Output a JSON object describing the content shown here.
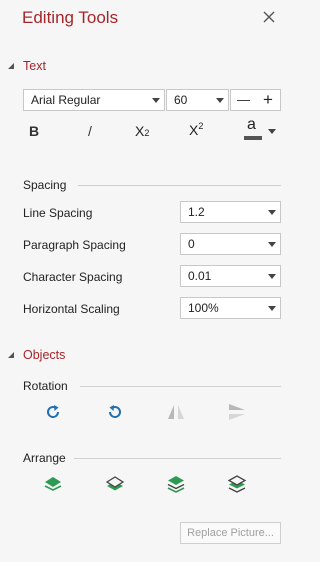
{
  "panel": {
    "title": "Editing Tools"
  },
  "text_section": {
    "header": "Text",
    "font_family": "Arial Regular",
    "font_size": "60",
    "decrease": "—",
    "increase": "+",
    "bold": "B",
    "italic": "/",
    "subscript": "X",
    "subscript_mark": "2",
    "superscript": "X",
    "superscript_mark": "2",
    "font_color_letter": "a"
  },
  "spacing": {
    "header": "Spacing",
    "rows": [
      {
        "label": "Line Spacing",
        "value": "1.2"
      },
      {
        "label": "Paragraph Spacing",
        "value": "0"
      },
      {
        "label": "Character Spacing",
        "value": "0.01"
      },
      {
        "label": "Horizontal Scaling",
        "value": "100%"
      }
    ]
  },
  "objects": {
    "header": "Objects",
    "rotation_label": "Rotation",
    "arrange_label": "Arrange",
    "replace_picture": "Replace Picture..."
  },
  "colors": {
    "accent": "#a4262c",
    "rotate_blue": "#1f6fb2",
    "arrange_green": "#2e9b55",
    "disabled_gray": "#b8b8b8"
  }
}
